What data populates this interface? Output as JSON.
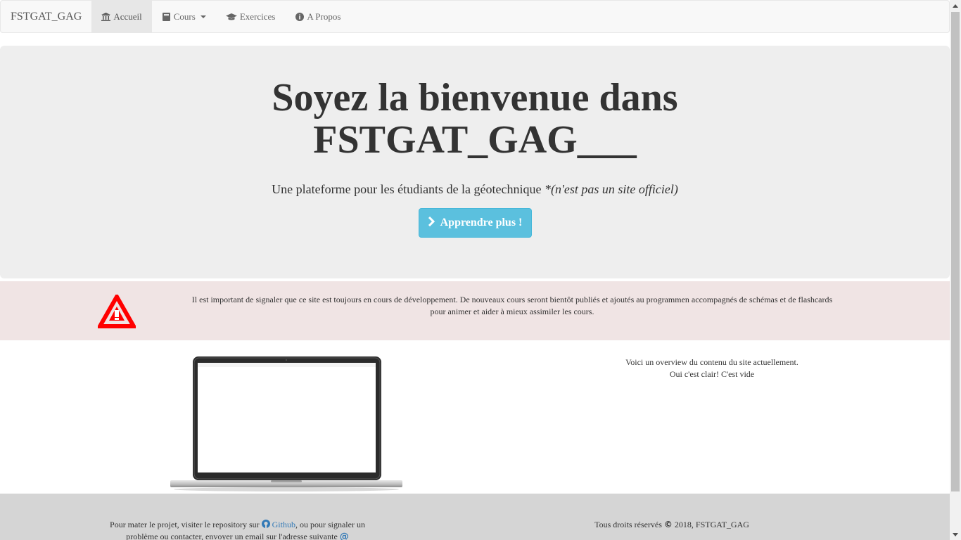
{
  "navbar": {
    "brand": "FSTGAT_GAG",
    "items": [
      {
        "label": "Accueil",
        "icon": "bank-icon"
      },
      {
        "label": "Cours",
        "icon": "book-icon"
      },
      {
        "label": "Exercices",
        "icon": "graduation-cap-icon"
      },
      {
        "label": "A Propos",
        "icon": "info-circle-icon"
      }
    ]
  },
  "hero": {
    "title_line1": "Soyez la bienvenue dans",
    "title_line2": "FSTGAT_GAG___",
    "subtitle": "Une plateforme pour les étudiants de la géotechnique ",
    "subtitle_note": "*(n'est pas un site officiel)",
    "button_label": "Apprendre plus !"
  },
  "warning": {
    "line1": "Il est important de signaler que ce site est toujours en cours de développement. De nouveaux cours seront bientôt publiés et ajoutés au programmen accompagnés de schémas et de flashcards",
    "line2": "pour animer et aider à mieux assimiler les cours."
  },
  "overview": {
    "line1": "Voici un overview du contenu du site actuellement.",
    "line2": "Oui c'est clair! C'est vide"
  },
  "footer": {
    "left_text_1": "Pour mater le projet, visiter le repository sur ",
    "github_label": "Github",
    "left_text_2": ", ou pour signaler un",
    "left_text_3": "problème ou contacter, envoyer un email sur l'adresse suivante ",
    "right_text_1": "Tous droits réservés ",
    "right_text_2": " 2018, FSTGAT_GAG"
  },
  "colors": {
    "button": "#5bc0de",
    "warning_bg": "#f0e4e4",
    "warning_icon": "#ff0000",
    "footer_bg": "#d5d5d5",
    "link": "#337ab7"
  }
}
